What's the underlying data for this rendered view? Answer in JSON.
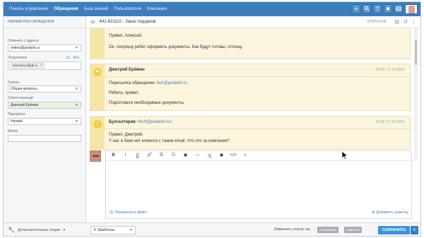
{
  "nav": {
    "items": [
      "Панель управления",
      "Обращения",
      "База знаний",
      "Пользователи",
      "Компании"
    ],
    "active_index": 1,
    "icons": [
      "plus-icon",
      "search-icon",
      "help-icon",
      "notifications-icon",
      "inbox-icon"
    ],
    "colors": {
      "bar": "#3d7ebf"
    }
  },
  "sidebar": {
    "title": "Параметры обращения",
    "reply_from_label": "Отвечать с адреса",
    "reply_from_value": "orders@podarki.ru",
    "recipient_label": "Получатель",
    "cc_label": "Cc",
    "bcc_label": "Bcc",
    "recipient_tag": "asemenov@gk.ru",
    "recipient_tag_remove": "✕",
    "group_label": "Группа",
    "group_value": "Общие вопросы",
    "responsible_label": "Ответственный",
    "responsible_value": "Дмитрий Ерёмин",
    "priority_label": "Приоритет",
    "priority_value": "Низкий",
    "tags_label": "Метки",
    "advanced_label": "Дополнительные опции",
    "advanced_caret": "▼"
  },
  "ticket": {
    "title": "641-621110 - Заказ подарков",
    "status": "Открытое"
  },
  "messages": [
    {
      "type": "client-reply",
      "lines": [
        "Привет, Алексей.",
        "Ок, попрошу ребят оформить документы. Как будут готовы, отпишу."
      ]
    },
    {
      "type": "forward",
      "author": "Дмитрий Ерёмин",
      "time": "16:34, 17.12.2019",
      "forward_prefix": "Пересылка обращения: ",
      "forward_email": "buh@podarki.ru",
      "lines": [
        "Ребята, привет.",
        "Подготовьте необходимые документы."
      ]
    },
    {
      "type": "note",
      "author": "Бухгалтерия",
      "email": "<buh@podarki.ru>",
      "time": "16:36, 17.12.2019",
      "lines": [
        "Привет, Дмитрий.",
        "У нас в базе нет клиента с таким email. Что это за компания?"
      ]
    }
  ],
  "editor": {
    "toolbar": [
      "B",
      "I",
      "U",
      "link",
      "bullet-list",
      "numbered-list",
      "image",
      "horizontal-rule",
      "text-color",
      "background-color",
      "code",
      "emoji"
    ],
    "attach_label": "Прикрепить файл",
    "add_note_label": "Добавить заметку"
  },
  "bottom": {
    "templates_label": "Шаблоны",
    "change_status_label": "Изменить статус на:",
    "status_buttons": [
      "в ожидании",
      "закрытое"
    ],
    "save_label": "Сохранить"
  }
}
